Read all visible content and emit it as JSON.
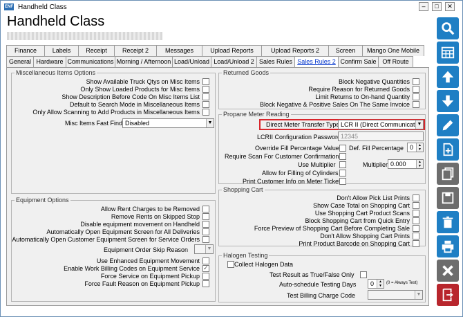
{
  "window": {
    "title": "Handheld Class",
    "heading": "Handheld Class",
    "icon_text": "ENF"
  },
  "tabs_row1": [
    {
      "label": "Finance"
    },
    {
      "label": "Labels"
    },
    {
      "label": "Receipt"
    },
    {
      "label": "Receipt 2"
    },
    {
      "label": "Messages"
    },
    {
      "label": "Upload Reports"
    },
    {
      "label": "Upload Reports 2"
    },
    {
      "label": "Screen"
    },
    {
      "label": "Mango One Mobile"
    }
  ],
  "tabs_row2": [
    {
      "label": "General"
    },
    {
      "label": "Hardware"
    },
    {
      "label": "Communications"
    },
    {
      "label": "Morning / Afternoon"
    },
    {
      "label": "Load/Unload"
    },
    {
      "label": "Load/Unload 2"
    },
    {
      "label": "Sales Rules"
    },
    {
      "label": "Sales Rules 2"
    },
    {
      "label": "Confirm Sale"
    },
    {
      "label": "Off Route"
    }
  ],
  "selected_tab": "Sales Rules 2",
  "misc": {
    "title": "Miscellaneous Items Options",
    "items": [
      {
        "label": "Show Available Truck Qtys on Misc Items"
      },
      {
        "label": "Only Show Loaded Products for Misc Items"
      },
      {
        "label": "Show Description Before Code On Misc Items List"
      },
      {
        "label": "Default to Search Mode in Miscellaneous Items"
      },
      {
        "label": "Only Allow Scanning to Add Products in Miscellaneous Items"
      }
    ],
    "fast_find_label": "Misc Items Fast Find",
    "fast_find_value": "Disabled"
  },
  "equipment": {
    "title": "Equipment Options",
    "items_a": [
      {
        "label": "Allow Rent Charges to be Removed"
      },
      {
        "label": "Remove Rents on Skipped Stop"
      },
      {
        "label": "Disable equipment movement on Handheld"
      },
      {
        "label": "Automatically Open Equipment Screen for All Deliveries"
      },
      {
        "label": "Automatically Open Customer Equipment Screen for Service Orders"
      }
    ],
    "skip_reason_label": "Equipment Order Skip Reason",
    "skip_reason_value": "",
    "items_b": [
      {
        "label": "Use Enhanced Equipment Movement"
      },
      {
        "label": "Enable Work Billing Codes on Equipment Service"
      },
      {
        "label": "Force Service on Equipment Pickup"
      },
      {
        "label": "Force Fault Reason on Equipment Pickup"
      }
    ]
  },
  "returned": {
    "title": "Returned Goods",
    "items": [
      {
        "label": "Block Negative Quantities"
      },
      {
        "label": "Require Reason for Returned Goods"
      },
      {
        "label": "Limit Returns to On-hand Quantity"
      },
      {
        "label": "Block Negative & Positive Sales On The Same Invoice"
      }
    ]
  },
  "propane": {
    "title": "Propane Meter Reading",
    "transfer_label": "Direct Meter Transfer Type",
    "transfer_value": "LCR II (Direct Communicatio",
    "lcr_password_label": "LCRII Configuration Password",
    "lcr_password_value": "12345",
    "override_label": "Override Fill Percentage Value",
    "def_fill_label": "Def. Fill Percentage",
    "def_fill_value": "0",
    "require_scan_label": "Require Scan For Customer Confirmation",
    "use_multiplier_label": "Use Multiplier",
    "multiplier_label": "Multiplier",
    "multiplier_value": "0.000",
    "allow_filling_label": "Allow for Filling of Cylinders",
    "print_customer_label": "Print Customer Info on Meter Ticket"
  },
  "cart": {
    "title": "Shopping Cart",
    "items": [
      {
        "label": "Don't Allow Pick List Prints"
      },
      {
        "label": "Show Case Total on Shopping Cart"
      },
      {
        "label": "Use Shopping Cart Product Scans"
      },
      {
        "label": "Block Shopping Cart from Quick Entry"
      },
      {
        "label": "Force Preview of Shopping Cart Before Completing Sale"
      },
      {
        "label": "Don't Allow Shopping Cart Prints"
      },
      {
        "label": "Print Product Barcode on Shopping Cart"
      }
    ]
  },
  "halogen": {
    "title": "Halogen Testing",
    "collect_label": "Collect Halogen Data",
    "truefalse_label": "Test Result as True/False Only",
    "auto_label": "Auto-schedule Testing Days",
    "auto_value": "0",
    "auto_note": "(0 = Always Test)",
    "billing_label": "Test Billing Charge Code",
    "billing_value": ""
  },
  "sidebar": [
    {
      "icon": "search-icon"
    },
    {
      "icon": "grid-icon"
    },
    {
      "icon": "arrow-up-icon"
    },
    {
      "icon": "arrow-down-icon"
    },
    {
      "icon": "edit-icon"
    },
    {
      "icon": "new-document-icon"
    },
    {
      "icon": "copy-icon"
    },
    {
      "icon": "save-icon"
    },
    {
      "icon": "delete-icon"
    },
    {
      "icon": "print-icon"
    },
    {
      "icon": "cancel-icon"
    },
    {
      "icon": "exit-icon"
    }
  ],
  "colors": {
    "accent": "#1f7fc4",
    "highlight": "#d9262c",
    "selected_tab_text": "#0033cc",
    "exit": "#b8262d"
  }
}
